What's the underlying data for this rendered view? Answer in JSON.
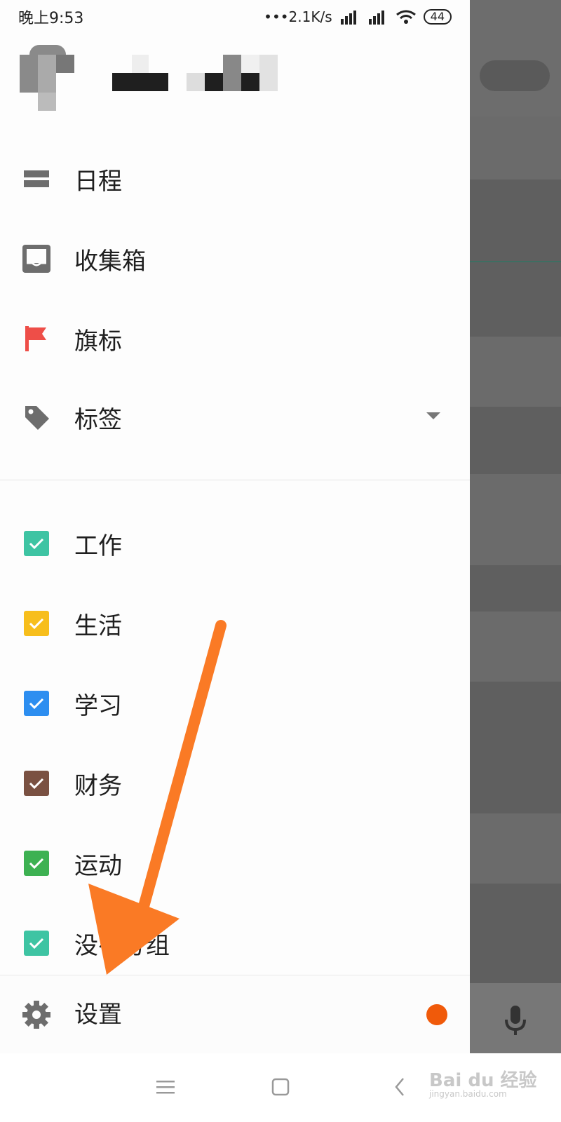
{
  "status_bar": {
    "time": "晚上9:53",
    "speed": "•••2.1K/s",
    "battery": "44"
  },
  "menu": {
    "items": [
      {
        "label": "日程",
        "icon": "calendar-bars-icon"
      },
      {
        "label": "收集箱",
        "icon": "inbox-icon"
      },
      {
        "label": "旗标",
        "icon": "flag-icon"
      },
      {
        "label": "标签",
        "icon": "tag-icon"
      }
    ],
    "lists": [
      {
        "label": "工作",
        "color": "#3ec4a3"
      },
      {
        "label": "生活",
        "color": "#f7be1c"
      },
      {
        "label": "学习",
        "color": "#2d8ef0"
      },
      {
        "label": "财务",
        "color": "#7a5142"
      },
      {
        "label": "运动",
        "color": "#3db152"
      },
      {
        "label": "没有分组",
        "color": "#3ec4a3"
      }
    ],
    "settings": {
      "label": "设置"
    }
  },
  "colors": {
    "flag": "#ee4e48",
    "badge": "#f05a0a",
    "arrow": "#fa7a25"
  },
  "watermark": {
    "text": "Bai du 经验",
    "sub": "jingyan.baidu.com"
  }
}
